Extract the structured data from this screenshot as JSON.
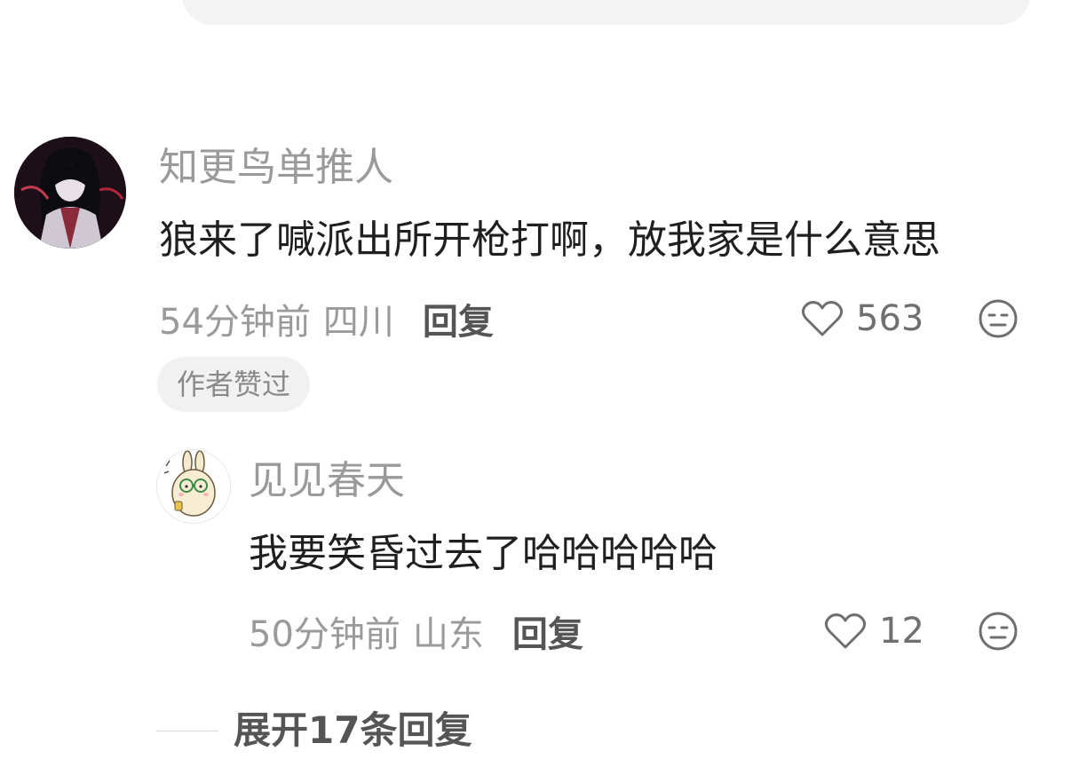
{
  "comment": {
    "username": "知更鸟单推人",
    "content": "狼来了喊派出所开枪打啊，放我家是什么意思",
    "time": "54分钟前",
    "location": "四川",
    "reply_label": "回复",
    "likes": "563",
    "badge": "作者赞过",
    "avatar_icon": "user-avatar",
    "like_icon": "heart-outline-icon",
    "dislike_icon": "meh-face-icon"
  },
  "reply": {
    "username": "见见春天",
    "content": "我要笑昏过去了哈哈哈哈哈",
    "time": "50分钟前",
    "location": "山东",
    "reply_label": "回复",
    "likes": "12",
    "avatar_icon": "rabbit-avatar",
    "like_icon": "heart-outline-icon",
    "dislike_icon": "meh-face-icon"
  },
  "expand_replies": "展开17条回复",
  "colors": {
    "username": "#9a9a9a",
    "content": "#1f1f1f",
    "meta": "#9a9a9a",
    "reply_button": "#555555",
    "badge_bg": "#f1f1f1"
  }
}
